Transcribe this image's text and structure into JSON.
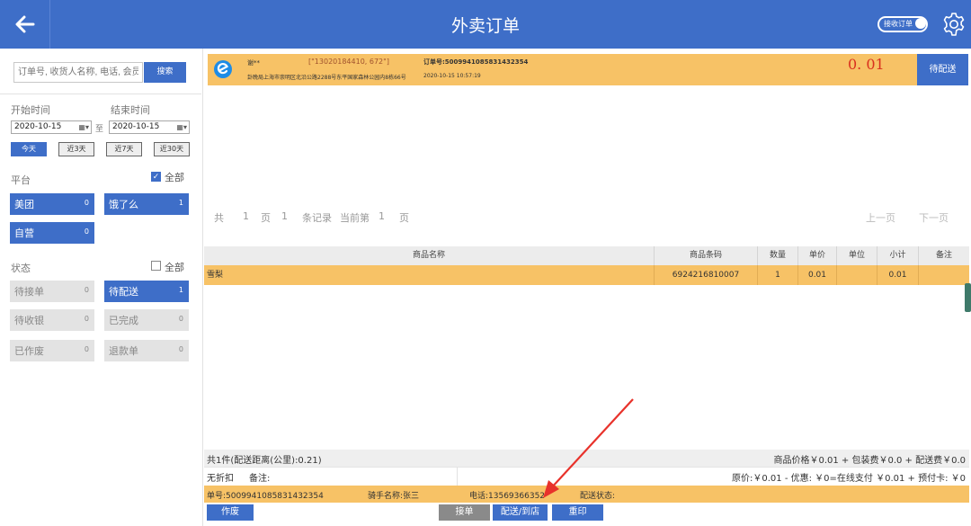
{
  "header": {
    "title": "外卖订单",
    "toggle_label": "接收订单"
  },
  "sidebar": {
    "search_placeholder": "订单号, 收货人名称, 电话, 会员",
    "search_button": "搜索",
    "start_time_label": "开始时间",
    "end_time_label": "结束时间",
    "start_date": "2020-10-15",
    "end_date": "2020-10-15",
    "to_label": "至",
    "quick_ranges": [
      "今天",
      "近3天",
      "近7天",
      "近30天"
    ],
    "platform_label": "平台",
    "all_label": "全部",
    "platform_all_checked": true,
    "platforms": [
      {
        "name": "美团",
        "count": "0",
        "active": true
      },
      {
        "name": "饿了么",
        "count": "1",
        "active": true
      },
      {
        "name": "自营",
        "count": "0",
        "active": true
      }
    ],
    "status_label": "状态",
    "status_all_checked": false,
    "statuses": [
      {
        "name": "待接单",
        "count": "0",
        "active": false
      },
      {
        "name": "待配送",
        "count": "1",
        "active": true
      },
      {
        "name": "待收银",
        "count": "0",
        "active": false
      },
      {
        "name": "已完成",
        "count": "0",
        "active": false
      },
      {
        "name": "已作废",
        "count": "0",
        "active": false
      },
      {
        "name": "退款单",
        "count": "0",
        "active": false
      }
    ]
  },
  "order": {
    "customer": "谢**",
    "coords": "[\"13020184410, 672\"]",
    "order_no_label": "订单号:5009941085831432354",
    "address": "卦晚局上海市崇明区北沿公路2288号东平国家森林公园内8栋66号",
    "time": "2020-10-15 10:57:19",
    "amount": "0. 01",
    "status": "待配送"
  },
  "pager": {
    "total_prefix": "共",
    "pages": "1",
    "page_unit": "页",
    "records": "1",
    "records_label": "条记录",
    "current_label": "当前第",
    "current": "1",
    "current_unit": "页",
    "prev": "上一页",
    "next": "下一页"
  },
  "items_table": {
    "headers": [
      "商品名称",
      "商品条码",
      "数量",
      "单价",
      "单位",
      "小计",
      "备注"
    ],
    "rows": [
      [
        "雪梨",
        "6924216810007",
        "1",
        "0.01",
        "",
        "0.01",
        ""
      ]
    ]
  },
  "summary": {
    "count_distance": "共1件(配送距离(公里):0.21)",
    "price_breakdown": "商品价格￥0.01 + 包装费￥0.0 + 配送费￥0.0",
    "discount": "无折扣",
    "remark_label": "备注:",
    "payment_breakdown": "原价:￥0.01 - 优惠: ￥0=在线支付 ￥0.01 + 预付卡: ￥0"
  },
  "info": {
    "order_no": "单号:5009941085831432354",
    "rider": "骑手名称:张三",
    "phone": "电话:13569366352",
    "delivery_status": "配送状态:"
  },
  "buttons": {
    "void": "作废",
    "accept": "接单",
    "deliver": "配送/到店",
    "reprint": "重印"
  },
  "colors": {
    "primary": "#3e6ec8",
    "highlight": "#f7c266",
    "amount": "#d9301e",
    "annotation_arrow": "#e8322b"
  }
}
